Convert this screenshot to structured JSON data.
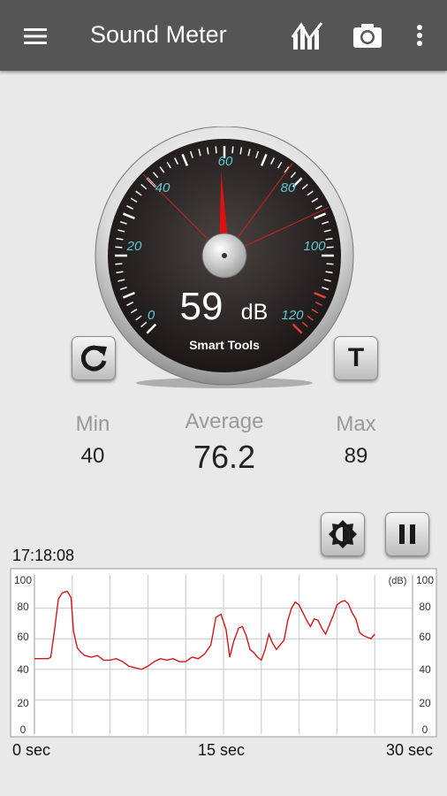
{
  "appbar": {
    "title": "Sound Meter",
    "menu_icon": "hamburger-menu-icon",
    "chart_icon": "statistics-chart-icon",
    "camera_icon": "camera-icon",
    "more_icon": "more-vert-icon",
    "background": "#555555"
  },
  "gauge": {
    "value": "59",
    "unit": "dB",
    "brand": "Smart Tools",
    "needle_db": 59,
    "scale_labels": [
      "0",
      "20",
      "40",
      "60",
      "80",
      "100",
      "120"
    ],
    "scale_color": "#5ec8d6",
    "needle_color": "#e01010"
  },
  "buttons": {
    "reset_icon": "refresh-icon",
    "t_label": "T",
    "brightness_icon": "brightness-icon",
    "pause_icon": "pause-icon"
  },
  "stats": {
    "min_label": "Min",
    "min_value": "40",
    "avg_label": "Average",
    "avg_value": "76.2",
    "max_label": "Max",
    "max_value": "89"
  },
  "graph": {
    "clock": "17:18:08",
    "unit_label": "(dB)",
    "y_ticks": [
      "100",
      "80",
      "60",
      "40",
      "20",
      "0"
    ],
    "x_labels": [
      "0 sec",
      "15 sec",
      "30 sec"
    ]
  },
  "chart_data": {
    "type": "line",
    "ylim": [
      0,
      100
    ],
    "xlim": [
      0,
      30
    ],
    "x": [
      0.0,
      0.8,
      1.1,
      1.3,
      1.6,
      1.9,
      2.2,
      2.6,
      2.9,
      3.1,
      3.4,
      3.7,
      4.0,
      4.5,
      5.0,
      5.5,
      6.0,
      6.5,
      7.0,
      7.5,
      8.0,
      8.5,
      9.0,
      9.5,
      10.0,
      10.5,
      11.0,
      11.5,
      12.0,
      12.5,
      13.0,
      13.5,
      14.0,
      14.4,
      14.8,
      15.2,
      15.5,
      15.8,
      16.2,
      16.5,
      16.8,
      17.1,
      17.4,
      17.7,
      18.0,
      18.3,
      18.6,
      18.9,
      19.2,
      19.5,
      19.8,
      20.1,
      20.4,
      20.7,
      21.0,
      21.3,
      21.6,
      21.9,
      22.2,
      22.5,
      22.8,
      23.1,
      23.4,
      23.7,
      24.0,
      24.3,
      24.6,
      24.9,
      25.2,
      25.5,
      25.8,
      26.1,
      26.4,
      26.7,
      27.0
    ],
    "y": [
      47,
      47,
      47,
      48,
      66,
      86,
      90,
      91,
      87,
      65,
      54,
      51,
      49,
      48,
      49,
      46,
      46,
      47,
      45,
      42,
      41,
      40,
      42,
      45,
      47,
      46,
      47,
      45,
      45,
      48,
      47,
      50,
      56,
      74,
      76,
      66,
      48,
      58,
      67,
      68,
      62,
      53,
      51,
      48,
      46,
      53,
      63,
      57,
      53,
      56,
      59,
      72,
      80,
      84,
      82,
      77,
      72,
      68,
      73,
      72,
      67,
      63,
      69,
      75,
      82,
      84,
      85,
      83,
      77,
      73,
      64,
      62,
      61,
      60,
      63
    ]
  }
}
